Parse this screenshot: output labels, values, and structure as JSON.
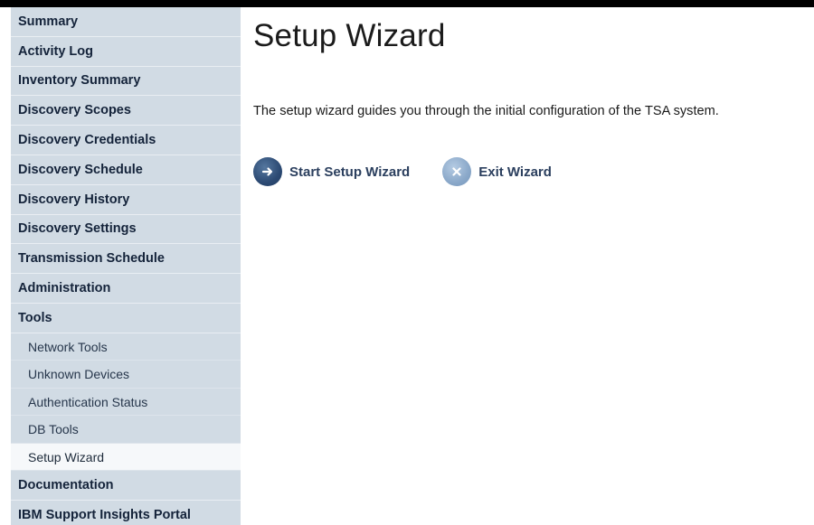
{
  "sidebar": {
    "items": [
      {
        "label": "Summary",
        "type": "section"
      },
      {
        "label": "Activity Log",
        "type": "section"
      },
      {
        "label": "Inventory Summary",
        "type": "section"
      },
      {
        "label": "Discovery Scopes",
        "type": "section"
      },
      {
        "label": "Discovery Credentials",
        "type": "section"
      },
      {
        "label": "Discovery Schedule",
        "type": "section"
      },
      {
        "label": "Discovery History",
        "type": "section"
      },
      {
        "label": "Discovery Settings",
        "type": "section"
      },
      {
        "label": "Transmission Schedule",
        "type": "section"
      },
      {
        "label": "Administration",
        "type": "section"
      },
      {
        "label": "Tools",
        "type": "section"
      },
      {
        "label": "Network Tools",
        "type": "sub"
      },
      {
        "label": "Unknown Devices",
        "type": "sub"
      },
      {
        "label": "Authentication Status",
        "type": "sub"
      },
      {
        "label": "DB Tools",
        "type": "sub"
      },
      {
        "label": "Setup Wizard",
        "type": "sub",
        "active": true
      },
      {
        "label": "Documentation",
        "type": "section"
      },
      {
        "label": "IBM Support Insights Portal",
        "type": "section"
      }
    ]
  },
  "main": {
    "title": "Setup Wizard",
    "description": "The setup wizard guides you through the initial configuration of the TSA system.",
    "actions": {
      "start_label": "Start Setup Wizard",
      "start_icon": "arrow-right-icon",
      "exit_label": "Exit Wizard",
      "exit_icon": "close-icon"
    }
  },
  "colors": {
    "sidebar_bg": "#d1dbe4",
    "active_item_bg": "#f6f8fa",
    "nav_text": "#14233a",
    "action_text": "#2b3f5e",
    "start_icon_bg": "#2c4a73",
    "exit_icon_bg": "#8aa8c9"
  }
}
